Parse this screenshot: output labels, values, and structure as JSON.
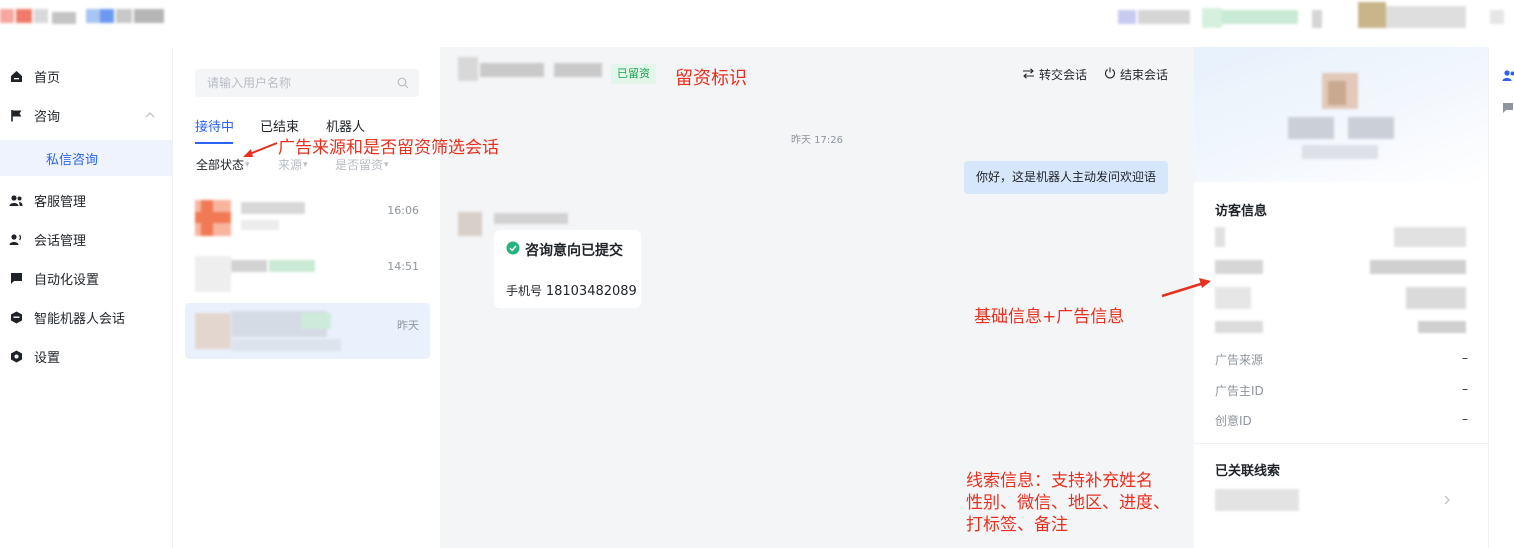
{
  "nav": {
    "items": [
      {
        "label": "首页",
        "icon": "home-icon"
      },
      {
        "label": "咨询",
        "icon": "flag-icon"
      },
      {
        "label": "私信咨询"
      },
      {
        "label": "客服管理",
        "icon": "users-icon"
      },
      {
        "label": "会话管理",
        "icon": "user-voice-icon"
      },
      {
        "label": "自动化设置",
        "icon": "chat-icon"
      },
      {
        "label": "智能机器人会话",
        "icon": "robot-icon"
      },
      {
        "label": "设置",
        "icon": "gear-icon"
      }
    ]
  },
  "sessions": {
    "search_placeholder": "请输入用户名称",
    "tabs": [
      "接待中",
      "已结束",
      "机器人"
    ],
    "filters": [
      "全部状态",
      "来源",
      "是否留资"
    ],
    "list": [
      {
        "time": "16:06"
      },
      {
        "time": "14:51"
      },
      {
        "time": "昨天"
      }
    ]
  },
  "chat": {
    "header_tag": "已留资",
    "transfer_label": "转交会话",
    "end_label": "结束会话",
    "timestamp": "昨天 17:26",
    "bot_message": "你好，这是机器人主动发问欢迎语",
    "card_title": "咨询意向已提交",
    "phone_label": "手机号",
    "phone_value": "18103482089"
  },
  "visitor": {
    "title": "访客信息",
    "fields": [
      {
        "label": "广告来源",
        "value": "–"
      },
      {
        "label": "广告主ID",
        "value": "–"
      },
      {
        "label": "创意ID",
        "value": "–"
      }
    ],
    "linked_title": "已关联线索"
  },
  "annotations": {
    "leads_tag": "留资标识",
    "filter_note": "广告来源和是否留资筛选会话",
    "basic_info": "基础信息+广告信息",
    "clue_info": [
      "线索信息：支持补充姓名",
      "性别、微信、地区、进度、",
      "打标签、备注"
    ]
  },
  "colors": {
    "accent": "#2b63f0",
    "annotation": "#e8301f",
    "success": "#17a34a"
  }
}
